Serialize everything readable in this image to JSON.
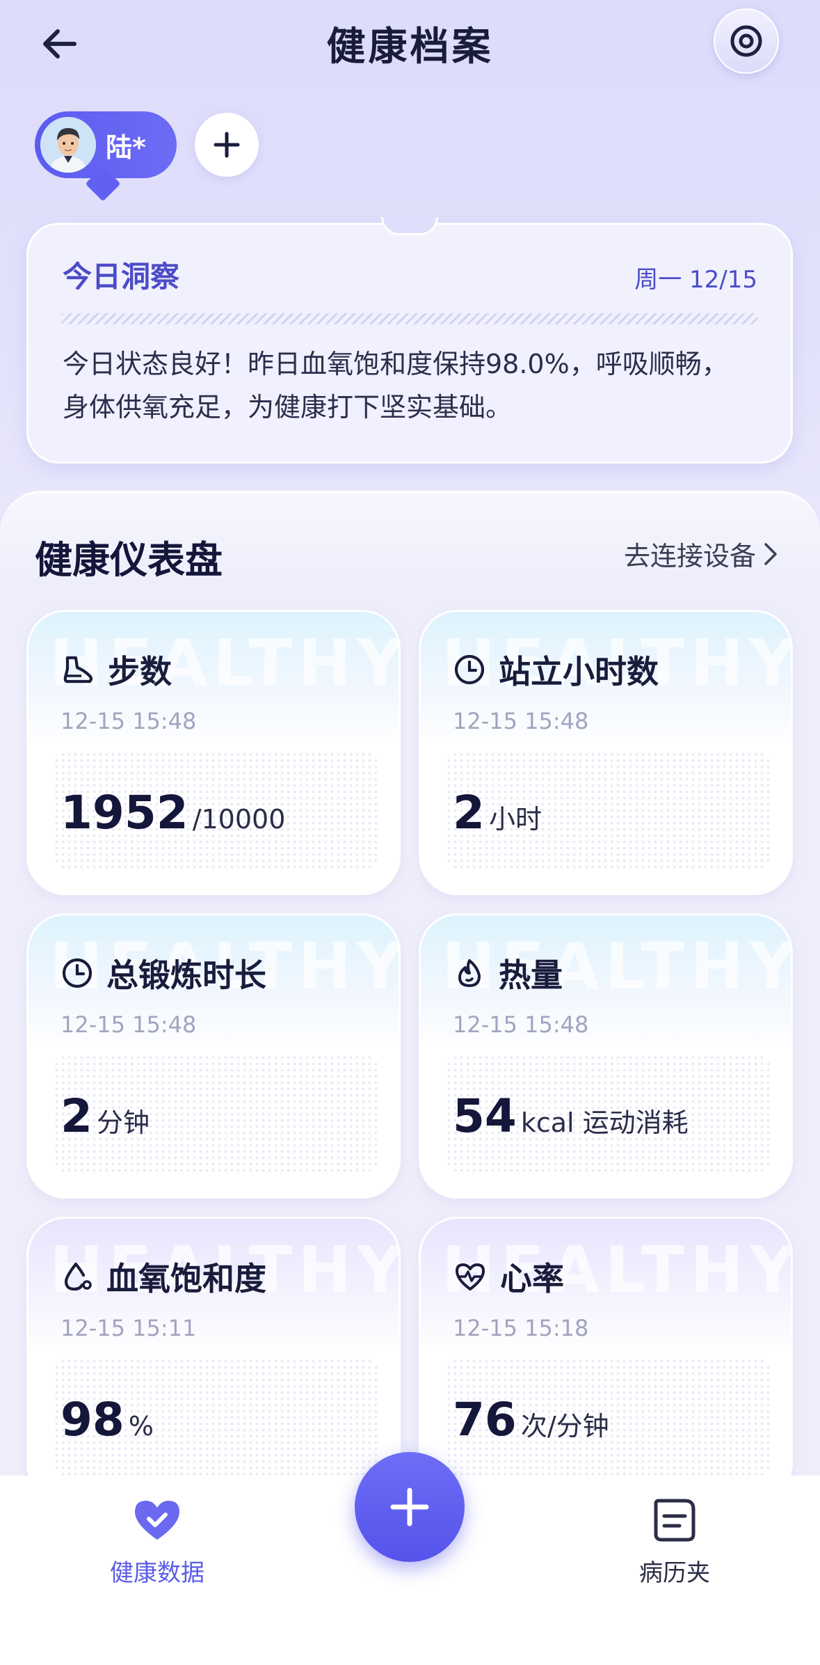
{
  "header": {
    "title": "健康档案",
    "back_icon": "arrow-left-icon",
    "settings_icon": "target-settings-icon"
  },
  "profile": {
    "name": "陆*",
    "add_icon": "plus-icon"
  },
  "insight": {
    "title": "今日洞察",
    "date": "周一 12/15",
    "text": "今日状态良好！昨日血氧饱和度保持98.0%，呼吸顺畅，身体供氧充足，为健康打下坚实基础。"
  },
  "dashboard": {
    "title": "健康仪表盘",
    "connect_label": "去连接设备",
    "watermark": "HEALTHY",
    "cards": [
      {
        "title": "步数",
        "time": "12-15 15:48",
        "value": "1952",
        "unit": "/10000",
        "icon": "shoe-icon"
      },
      {
        "title": "站立小时数",
        "time": "12-15 15:48",
        "value": "2",
        "unit": "小时",
        "icon": "clock-icon"
      },
      {
        "title": "总锻炼时长",
        "time": "12-15 15:48",
        "value": "2",
        "unit": "分钟",
        "icon": "clock-icon"
      },
      {
        "title": "热量",
        "time": "12-15 15:48",
        "value": "54",
        "unit": "kcal 运动消耗",
        "icon": "flame-icon"
      },
      {
        "title": "血氧饱和度",
        "time": "12-15 15:11",
        "value": "98",
        "unit": "%",
        "icon": "drop-icon"
      },
      {
        "title": "心率",
        "time": "12-15 15:18",
        "value": "76",
        "unit": "次/分钟",
        "icon": "heart-pulse-icon"
      }
    ]
  },
  "nav": {
    "health_data": "健康数据",
    "records": "病历夹",
    "active_color": "#5b5ce8",
    "inactive_color": "#2b2d45"
  }
}
